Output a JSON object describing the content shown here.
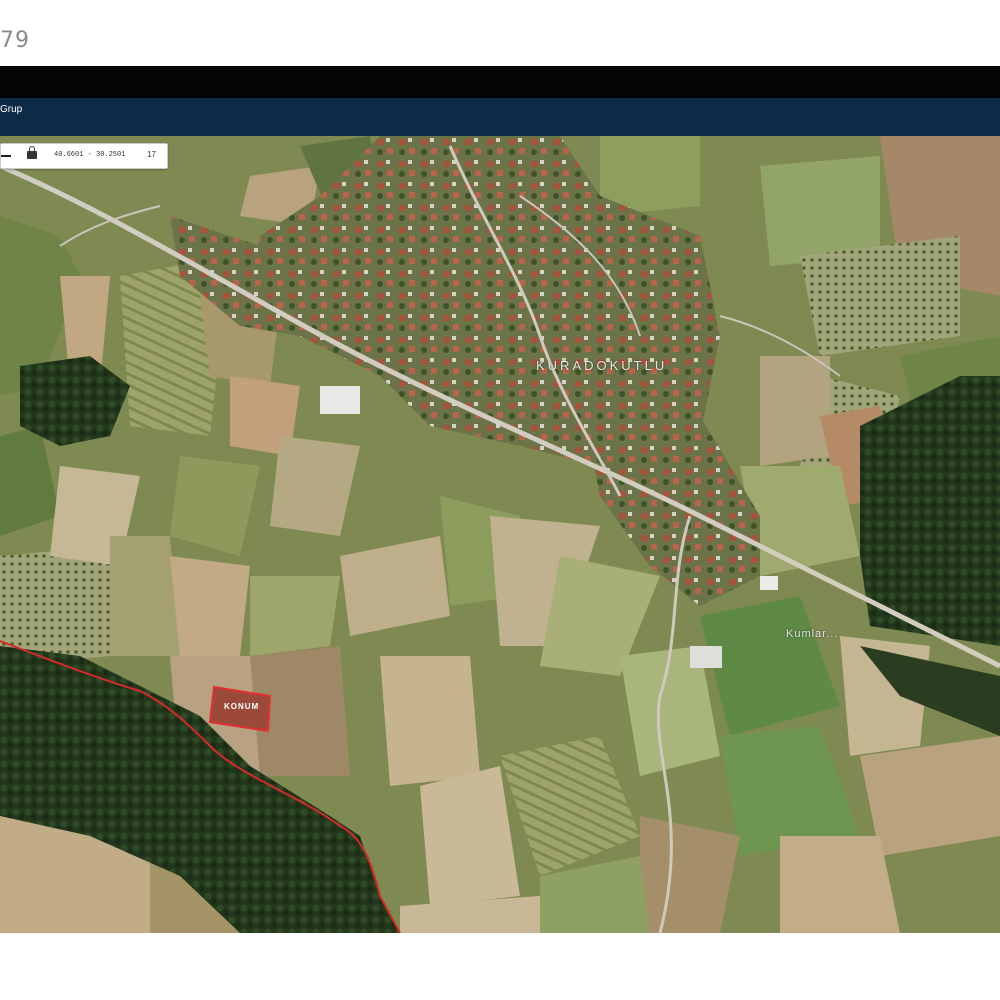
{
  "header": {
    "listing_number_fragment": "79",
    "nav_title": "Grup"
  },
  "toolbar": {
    "coordinates": "40.6601 - 30.2501",
    "zoom": "17"
  },
  "map": {
    "village_label": "KURADOKUTLU",
    "road_label": "Kumlar...",
    "parcel_label": "KONUM",
    "boundary_color": "#d42a2a"
  },
  "icons": {
    "lock": "lock-icon",
    "menu": "menu-icon"
  }
}
